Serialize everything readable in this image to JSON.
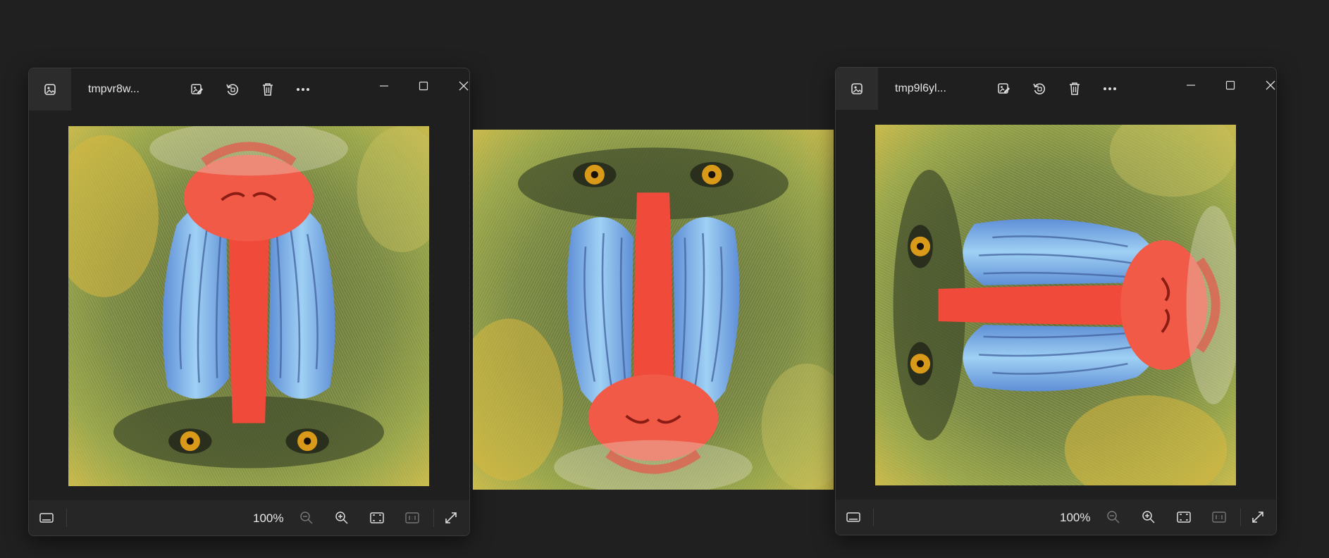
{
  "windows": [
    {
      "title": "tmpvr8w...",
      "zoom": "100%",
      "icons": [
        "photos-app-icon",
        "edit-image-icon",
        "rotate-icon",
        "delete-icon",
        "more-icon",
        "minimize-icon",
        "maximize-icon",
        "close-icon",
        "filmstrip-icon",
        "zoom-out-icon",
        "zoom-in-icon",
        "fit-to-window-icon",
        "actual-size-icon",
        "fullscreen-icon"
      ],
      "image_orientation": "flipped-vertical"
    },
    {
      "title": "tmp9l6yl...",
      "zoom": "100%",
      "icons": [
        "photos-app-icon",
        "edit-image-icon",
        "rotate-icon",
        "delete-icon",
        "more-icon",
        "minimize-icon",
        "maximize-icon",
        "close-icon",
        "filmstrip-icon",
        "zoom-out-icon",
        "zoom-in-icon",
        "fit-to-window-icon",
        "actual-size-icon",
        "fullscreen-icon"
      ],
      "image_orientation": "rotated-90-ccw"
    }
  ],
  "standalone_image": {
    "orientation": "upright"
  },
  "colors": {
    "desktop": "#202020",
    "window": "#1f1f1f",
    "bottombar": "#262626",
    "fur": "#6f7a3a",
    "nose": "#f04a3a",
    "cheek": "#7fb4e6",
    "eye": "#d99a1a"
  }
}
